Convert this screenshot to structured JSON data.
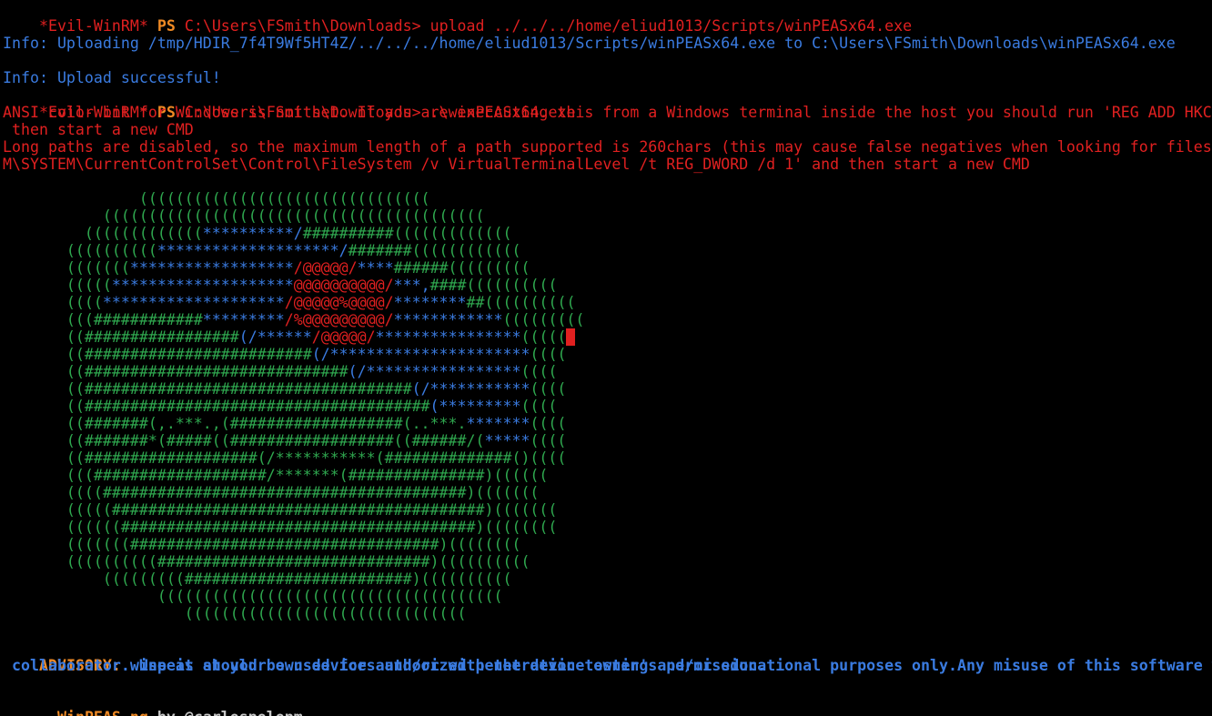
{
  "colors": {
    "background": "#000000",
    "prompt_red": "#e02020",
    "prompt_orange": "#f08a24",
    "info_blue": "#3a7be0",
    "ascii_green": "#2fa84f",
    "ascii_blue": "#3a7be0",
    "ascii_red": "#e02020",
    "text_gray": "#c8c8c8"
  },
  "session": {
    "prompt_name": "*Evil-WinRM*",
    "prompt_ps": "PS",
    "cwd_prompt": "C:\\Users\\FSmith\\Downloads>"
  },
  "commands": {
    "upload": " upload ../../../home/eliud1013/Scripts/winPEASx64.exe",
    "run": " .\\winPEASx64.exe"
  },
  "info": {
    "uploading": "Info: Uploading /tmp/HDIR_7f4T9Wf5HT4Z/../../../home/eliud1013/Scripts/winPEASx64.exe to C:\\Users\\FSmith\\Downloads\\winPEASx64.exe",
    "success": "Info: Upload successful!"
  },
  "warnings": {
    "ansi_1": "ANSI color bit for Windows is not set. If you are execcuting this from a Windows terminal inside the host you should run 'REG ADD HKC",
    "ansi_2": " then start a new CMD",
    "longpath_1": "Long paths are disabled, so the maximum length of a path supported is 260chars (this may cause false negatives when looking for files",
    "longpath_2": "M\\SYSTEM\\CurrentControlSet\\Control\\FileSystem /v VirtualTerminalLevel /t REG_DWORD /d 1' and then start a new CMD"
  },
  "ascii_art": [
    [
      [
        "g",
        "               (((((((((((((((((((((((((((((((("
      ]
    ],
    [
      [
        "g",
        "           (((((((((((((((((((((((((((((((((((((((((("
      ]
    ],
    [
      [
        "g",
        "         ((((((((((((("
      ],
      [
        "b",
        "**********/"
      ],
      [
        "g",
        "##########((((((((((((("
      ]
    ],
    [
      [
        "g",
        "       (((((((((("
      ],
      [
        "b",
        "********************/"
      ],
      [
        "g",
        "#######(((((((((((("
      ]
    ],
    [
      [
        "g",
        "       ((((((("
      ],
      [
        "b",
        "******************"
      ],
      [
        "r",
        "/@@@@@/"
      ],
      [
        "b",
        "****"
      ],
      [
        "g",
        "######((((((((("
      ]
    ],
    [
      [
        "g",
        "       ((((("
      ],
      [
        "b",
        "********************"
      ],
      [
        "r",
        "@@@@@@@@@@/"
      ],
      [
        "b",
        "***,"
      ],
      [
        "g",
        "####(((((((((("
      ]
    ],
    [
      [
        "g",
        "       (((("
      ],
      [
        "b",
        "********************"
      ],
      [
        "r",
        "/@@@@@%@@@@/"
      ],
      [
        "b",
        "********"
      ],
      [
        "g",
        "##(((((((((("
      ]
    ],
    [
      [
        "g",
        "       ((("
      ],
      [
        "g",
        "############"
      ],
      [
        "b",
        "*********"
      ],
      [
        "r",
        "/%@@@@@@@@@/"
      ],
      [
        "b",
        "************"
      ],
      [
        "g",
        "((((((((("
      ]
    ],
    [
      [
        "g",
        "       (("
      ],
      [
        "g",
        "#################"
      ],
      [
        "b",
        "(/******"
      ],
      [
        "r",
        "/@@@@@/"
      ],
      [
        "b",
        "****************"
      ],
      [
        "g",
        "((((("
      ]
    ],
    [
      [
        "g",
        "       (("
      ],
      [
        "g",
        "#########################"
      ],
      [
        "b",
        "(/**********************"
      ],
      [
        "g",
        "(((("
      ]
    ],
    [
      [
        "g",
        "       ((#############################"
      ],
      [
        "b",
        "(/*****************"
      ],
      [
        "g",
        "(((("
      ]
    ],
    [
      [
        "g",
        "       ((####################################"
      ],
      [
        "b",
        "(/***********"
      ],
      [
        "g",
        "(((("
      ]
    ],
    [
      [
        "g",
        "       ((######################################"
      ],
      [
        "b",
        "(*********"
      ],
      [
        "g",
        "(((("
      ]
    ],
    [
      [
        "g",
        "       ((#######(,.***.,(###################(..***."
      ],
      [
        "b",
        "*******"
      ],
      [
        "g",
        "(((("
      ]
    ],
    [
      [
        "g",
        "       ((#######*(#####((##################((######/("
      ],
      [
        "b",
        "*****"
      ],
      [
        "g",
        "(((("
      ]
    ],
    [
      [
        "g",
        "       ((###################(/***********(##############()(((("
      ]
    ],
    [
      [
        "g",
        "       (((###################/*******(###############)(((((("
      ]
    ],
    [
      [
        "g",
        "       ((((########################################)((((((("
      ]
    ],
    [
      [
        "g",
        "       (((((#########################################)((((((("
      ]
    ],
    [
      [
        "g",
        "       ((((((#######################################)(((((((("
      ]
    ],
    [
      [
        "g",
        "       (((((((##################################)(((((((("
      ]
    ],
    [
      [
        "g",
        "       ((((((((((##############################)(((((((((("
      ]
    ],
    [
      [
        "g",
        "           (((((((((#########################)(((((((((("
      ]
    ],
    [
      [
        "g",
        "                 (((((((((((((((((((((((((((((((((((((("
      ]
    ],
    [
      [
        "g",
        "                    ((((((((((((((((((((((((((((((("
      ]
    ]
  ],
  "advisory": {
    "label": "ADVISORY:",
    "text_1": " winpeas should be used for authorized penetration testing and/or educational purposes only.Any misuse of this software will",
    "text_2": " collaborator. Use it at your own devices and/or with the device owner's permission."
  },
  "footer": {
    "name": "WinPEAS-ng",
    "by": " by @carlospolopm"
  }
}
